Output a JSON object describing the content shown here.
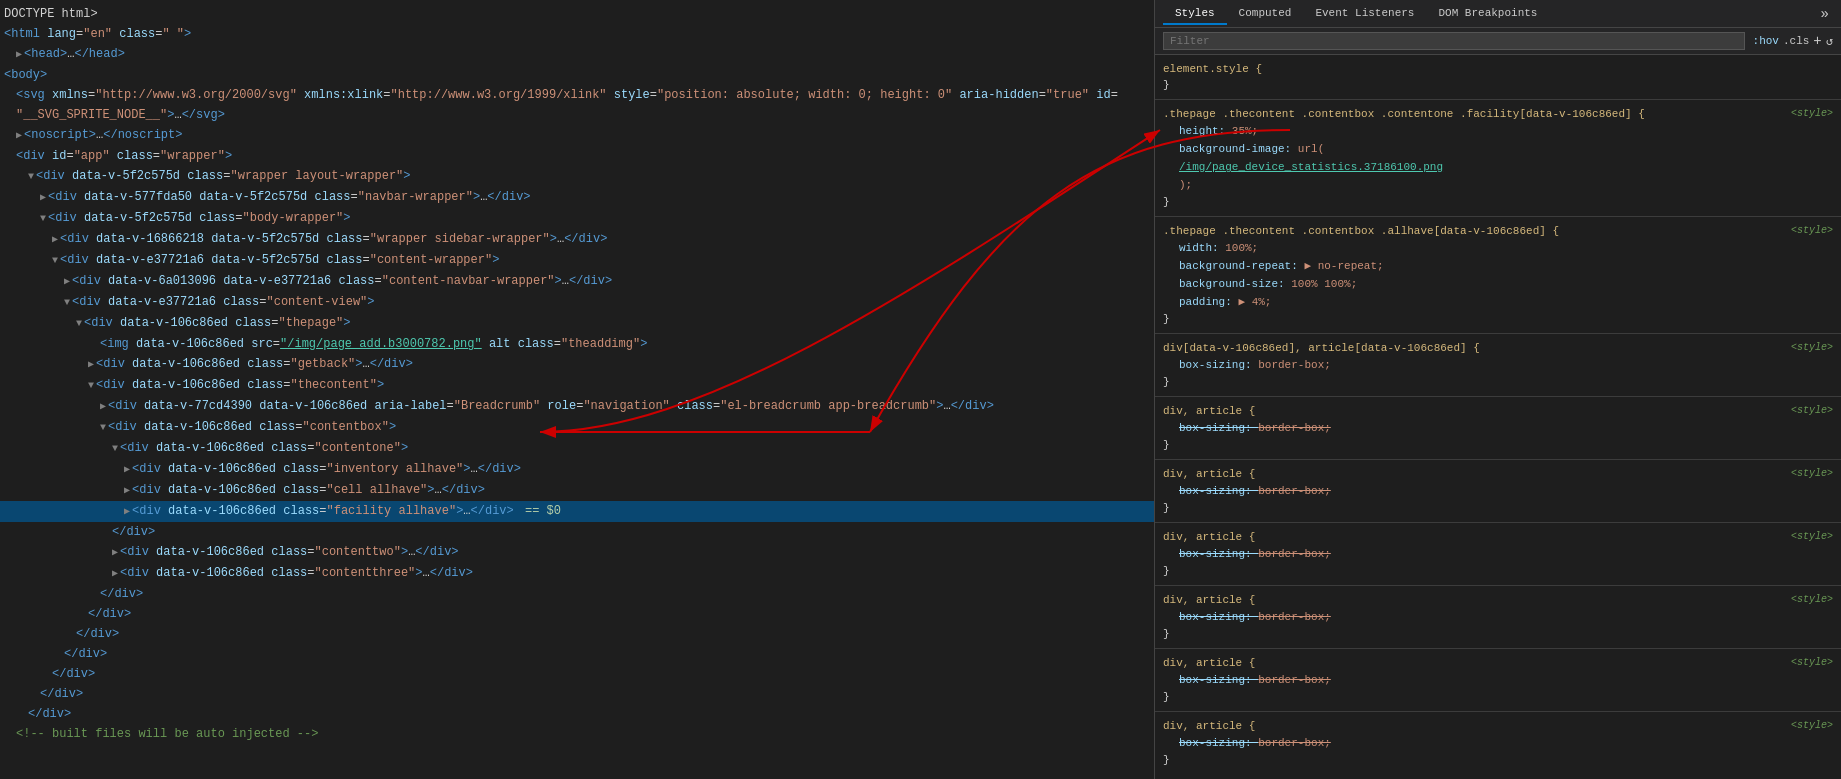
{
  "dom_panel": {
    "lines": [
      {
        "id": 0,
        "indent": 0,
        "selected": false,
        "content": "DOCTYPE html>",
        "type": "doctype"
      },
      {
        "id": 1,
        "indent": 0,
        "selected": false,
        "html": "<span class='tag'>&lt;html</span> <span class='attr-name'>lang</span><span class='equals'>=</span><span class='attr-value'>\"en\"</span> <span class='attr-name'>class</span><span class='equals'>=</span><span class='attr-value'>\" \"</span><span class='tag'>&gt;</span>"
      },
      {
        "id": 2,
        "indent": 1,
        "selected": false,
        "html": "<span class='triangle'>▶</span><span class='tag'>&lt;head&gt;</span>…<span class='tag'>&lt;/head&gt;</span>"
      },
      {
        "id": 3,
        "indent": 0,
        "selected": false,
        "html": "<span class='tag'>&lt;body&gt;</span>"
      },
      {
        "id": 4,
        "indent": 1,
        "selected": false,
        "html": "<span class='tag'>&lt;svg</span> <span class='attr-name'>xmlns</span><span class='equals'>=</span><span class='attr-value'>\"http://www.w3.org/2000/svg\"</span> <span class='attr-name'>xmlns:xlink</span><span class='equals'>=</span><span class='attr-value'>\"http://www.w3.org/1999/xlink\"</span> <span class='attr-name'>style</span><span class='equals'>=</span><span class='attr-value'>\"position: absolute; width: 0; height: 0\"</span> <span class='attr-name'>aria-hidden</span><span class='equals'>=</span><span class='attr-value'>\"true\"</span> <span class='attr-name'>id</span><span class='equals'>=</span>"
      },
      {
        "id": 5,
        "indent": 1,
        "selected": false,
        "html": "<span class='attr-value'>\"__SVG_SPRITE_NODE__\"</span><span class='tag'>&gt;</span>…<span class='tag'>&lt;/svg&gt;</span>"
      },
      {
        "id": 6,
        "indent": 1,
        "selected": false,
        "html": "<span class='triangle'>▶</span><span class='tag'>&lt;noscript&gt;</span>…<span class='tag'>&lt;/noscript&gt;</span>"
      },
      {
        "id": 7,
        "indent": 1,
        "selected": false,
        "html": "<span class='tag'>&lt;div</span> <span class='attr-name'>id</span><span class='equals'>=</span><span class='attr-value'>\"app\"</span> <span class='attr-name'>class</span><span class='equals'>=</span><span class='attr-value'>\"wrapper\"</span><span class='tag'>&gt;</span>"
      },
      {
        "id": 8,
        "indent": 2,
        "selected": false,
        "html": "<span class='triangle'>▼</span><span class='tag'>&lt;div</span> <span class='attr-name'>data-v-5f2c575d</span> <span class='attr-name'>class</span><span class='equals'>=</span><span class='attr-value'>\"wrapper layout-wrapper\"</span><span class='tag'>&gt;</span>"
      },
      {
        "id": 9,
        "indent": 3,
        "selected": false,
        "html": "<span class='triangle'>▶</span><span class='tag'>&lt;div</span> <span class='attr-name'>data-v-577fda50</span> <span class='attr-name'>data-v-5f2c575d</span> <span class='attr-name'>class</span><span class='equals'>=</span><span class='attr-value'>\"navbar-wrapper\"</span><span class='tag'>&gt;</span>…<span class='tag'>&lt;/div&gt;</span>"
      },
      {
        "id": 10,
        "indent": 3,
        "selected": false,
        "html": "<span class='triangle'>▼</span><span class='tag'>&lt;div</span> <span class='attr-name'>data-v-5f2c575d</span> <span class='attr-name'>class</span><span class='equals'>=</span><span class='attr-value'>\"body-wrapper\"</span><span class='tag'>&gt;</span>"
      },
      {
        "id": 11,
        "indent": 4,
        "selected": false,
        "html": "<span class='triangle'>▶</span><span class='tag'>&lt;div</span> <span class='attr-name'>data-v-16866218</span> <span class='attr-name'>data-v-5f2c575d</span> <span class='attr-name'>class</span><span class='equals'>=</span><span class='attr-value'>\"wrapper sidebar-wrapper\"</span><span class='tag'>&gt;</span>…<span class='tag'>&lt;/div&gt;</span>"
      },
      {
        "id": 12,
        "indent": 4,
        "selected": false,
        "html": "<span class='triangle'>▼</span><span class='tag'>&lt;div</span> <span class='attr-name'>data-v-e37721a6</span> <span class='attr-name'>data-v-5f2c575d</span> <span class='attr-name'>class</span><span class='equals'>=</span><span class='attr-value'>\"content-wrapper\"</span><span class='tag'>&gt;</span>"
      },
      {
        "id": 13,
        "indent": 5,
        "selected": false,
        "html": "<span class='triangle'>▶</span><span class='tag'>&lt;div</span> <span class='attr-name'>data-v-6a013096</span> <span class='attr-name'>data-v-e37721a6</span> <span class='attr-name'>class</span><span class='equals'>=</span><span class='attr-value'>\"content-navbar-wrapper\"</span><span class='tag'>&gt;</span>…<span class='tag'>&lt;/div&gt;</span>"
      },
      {
        "id": 14,
        "indent": 5,
        "selected": false,
        "html": "<span class='triangle'>▼</span><span class='tag'>&lt;div</span> <span class='attr-name'>data-v-e37721a6</span> <span class='attr-name'>class</span><span class='equals'>=</span><span class='attr-value'>\"content-view\"</span><span class='tag'>&gt;</span>"
      },
      {
        "id": 15,
        "indent": 6,
        "selected": false,
        "html": "<span class='triangle'>▼</span><span class='tag'>&lt;div</span> <span class='attr-name'>data-v-106c86ed</span> <span class='attr-name'>class</span><span class='equals'>=</span><span class='attr-value'>\"thepage\"</span><span class='tag'>&gt;</span>"
      },
      {
        "id": 16,
        "indent": 7,
        "selected": false,
        "html": "<span class='triangle-placeholder'></span><span class='tag'>&lt;img</span> <span class='attr-name'>data-v-106c86ed</span> <span class='attr-name'>src</span><span class='equals'>=</span><span class='attr-value attr-link'><a class='link-text' href='#'>\"/img/page_add.b3000782.png\"</a></span> <span class='attr-name'>alt</span> <span class='attr-name'>class</span><span class='equals'>=</span><span class='attr-value'>\"theaddimg\"</span><span class='tag'>&gt;</span>"
      },
      {
        "id": 17,
        "indent": 7,
        "selected": false,
        "html": "<span class='triangle'>▶</span><span class='tag'>&lt;div</span> <span class='attr-name'>data-v-106c86ed</span> <span class='attr-name'>class</span><span class='equals'>=</span><span class='attr-value'>\"getback\"</span><span class='tag'>&gt;</span>…<span class='tag'>&lt;/div&gt;</span>"
      },
      {
        "id": 18,
        "indent": 7,
        "selected": false,
        "html": "<span class='triangle'>▼</span><span class='tag'>&lt;div</span> <span class='attr-name'>data-v-106c86ed</span> <span class='attr-name'>class</span><span class='equals'>=</span><span class='attr-value'>\"thecontent\"</span><span class='tag'>&gt;</span>"
      },
      {
        "id": 19,
        "indent": 8,
        "selected": false,
        "html": "<span class='triangle'>▶</span><span class='tag'>&lt;div</span> <span class='attr-name'>data-v-77cd4390</span> <span class='attr-name'>data-v-106c86ed</span> <span class='attr-name'>aria-label</span><span class='equals'>=</span><span class='attr-value'>\"Breadcrumb\"</span> <span class='attr-name'>role</span><span class='equals'>=</span><span class='attr-value'>\"navigation\"</span> <span class='attr-name'>class</span><span class='equals'>=</span><span class='attr-value'>\"el-breadcrumb app-breadcrumb\"</span><span class='tag'>&gt;</span>…<span class='tag'>&lt;/div&gt;</span>"
      },
      {
        "id": 20,
        "indent": 8,
        "selected": false,
        "html": "<span class='triangle'>▼</span><span class='tag'>&lt;div</span> <span class='attr-name'>data-v-106c86ed</span> <span class='attr-name'>class</span><span class='equals'>=</span><span class='attr-value'>\"contentbox\"</span><span class='tag'>&gt;</span>"
      },
      {
        "id": 21,
        "indent": 9,
        "selected": false,
        "html": "<span class='triangle'>▼</span><span class='tag'>&lt;div</span> <span class='attr-name'>data-v-106c86ed</span> <span class='attr-name'>class</span><span class='equals'>=</span><span class='attr-value'>\"contentone\"</span><span class='tag'>&gt;</span>"
      },
      {
        "id": 22,
        "indent": 10,
        "selected": false,
        "html": "<span class='triangle'>▶</span><span class='tag'>&lt;div</span> <span class='attr-name'>data-v-106c86ed</span> <span class='attr-name'>class</span><span class='equals'>=</span><span class='attr-value'>\"inventory allhave\"</span><span class='tag'>&gt;</span>…<span class='tag'>&lt;/div&gt;</span>"
      },
      {
        "id": 23,
        "indent": 10,
        "selected": false,
        "html": "<span class='triangle'>▶</span><span class='tag'>&lt;div</span> <span class='attr-name'>data-v-106c86ed</span> <span class='attr-name'>class</span><span class='equals'>=</span><span class='attr-value'>\"cell allhave\"</span><span class='tag'>&gt;</span>…<span class='tag'>&lt;/div&gt;</span>"
      },
      {
        "id": 24,
        "indent": 10,
        "selected": true,
        "html": "<span class='triangle'>▶</span><span class='tag'>&lt;div</span> <span class='attr-name'>data-v-106c86ed</span> <span class='attr-name'>class</span><span class='equals'>=</span><span class='attr-value'>\"facility allhave\"</span><span class='tag'>&gt;</span>…<span class='tag'>&lt;/div&gt;</span> <span class='selected-marker'>== $0</span>"
      },
      {
        "id": 25,
        "indent": 9,
        "selected": false,
        "html": "<span class='tag'>&lt;/div&gt;</span>"
      },
      {
        "id": 26,
        "indent": 9,
        "selected": false,
        "html": "<span class='triangle'>▶</span><span class='tag'>&lt;div</span> <span class='attr-name'>data-v-106c86ed</span> <span class='attr-name'>class</span><span class='equals'>=</span><span class='attr-value'>\"contenttwo\"</span><span class='tag'>&gt;</span>…<span class='tag'>&lt;/div&gt;</span>"
      },
      {
        "id": 27,
        "indent": 9,
        "selected": false,
        "html": "<span class='triangle'>▶</span><span class='tag'>&lt;div</span> <span class='attr-name'>data-v-106c86ed</span> <span class='attr-name'>class</span><span class='equals'>=</span><span class='attr-value'>\"contentthree\"</span><span class='tag'>&gt;</span>…<span class='tag'>&lt;/div&gt;</span>"
      },
      {
        "id": 28,
        "indent": 8,
        "selected": false,
        "html": "<span class='tag'>&lt;/div&gt;</span>"
      },
      {
        "id": 29,
        "indent": 7,
        "selected": false,
        "html": "<span class='tag'>&lt;/div&gt;</span>"
      },
      {
        "id": 30,
        "indent": 6,
        "selected": false,
        "html": "<span class='tag'>&lt;/div&gt;</span>"
      },
      {
        "id": 31,
        "indent": 5,
        "selected": false,
        "html": "<span class='tag'>&lt;/div&gt;</span>"
      },
      {
        "id": 32,
        "indent": 4,
        "selected": false,
        "html": "<span class='tag'>&lt;/div&gt;</span>"
      },
      {
        "id": 33,
        "indent": 3,
        "selected": false,
        "html": "<span class='tag'>&lt;/div&gt;</span>"
      },
      {
        "id": 34,
        "indent": 2,
        "selected": false,
        "html": "<span class='tag'>&lt;/div&gt;</span>"
      },
      {
        "id": 35,
        "indent": 1,
        "selected": false,
        "html": "<span class='comment'>&lt;!-- built files will be auto injected --&gt;</span>"
      }
    ]
  },
  "styles_panel": {
    "tabs": [
      {
        "label": "Styles",
        "active": true
      },
      {
        "label": "Computed",
        "active": false
      },
      {
        "label": "Event Listeners",
        "active": false
      },
      {
        "label": "DOM Breakpoints",
        "active": false
      }
    ],
    "filter_placeholder": "Filter",
    "filter_pseudo": ":hov",
    "filter_cls": ".cls",
    "rules": [
      {
        "selector": "element.style {",
        "source": "",
        "properties": [],
        "closing": "}"
      },
      {
        "selector": ".thepage .thecontent .contentbox .contentone .facility[data-v-106c86ed] {",
        "source": "<style>",
        "properties": [
          {
            "name": "height",
            "value": "35%;",
            "strikethrough": false,
            "arrow": true
          },
          {
            "name": "background-image",
            "value": "url(",
            "strikethrough": false
          },
          {
            "name": "",
            "value": "/img/page_device_statistics.37186100.png",
            "strikethrough": false,
            "is_link": true
          },
          {
            "name": "",
            "value": ");",
            "strikethrough": false
          }
        ],
        "closing": "}"
      },
      {
        "selector": ".thepage .thecontent .contentbox .allhave[data-v-106c86ed] {",
        "source": "<style>",
        "properties": [
          {
            "name": "width",
            "value": "100%;",
            "strikethrough": false
          },
          {
            "name": "background-repeat",
            "value": "▶ no-repeat;",
            "strikethrough": false
          },
          {
            "name": "background-size",
            "value": "100% 100%;",
            "strikethrough": false
          },
          {
            "name": "padding",
            "value": "▶ 4%;",
            "strikethrough": false
          }
        ],
        "closing": "}"
      },
      {
        "selector": "div[data-v-106c86ed], article[data-v-106c86ed] {",
        "source": "<style>",
        "properties": [
          {
            "name": "box-sizing",
            "value": "border-box;",
            "strikethrough": false
          }
        ],
        "closing": "}"
      },
      {
        "selector": "div, article {",
        "source": "<style>",
        "properties": [
          {
            "name": "box-sizing",
            "value": "border-box;",
            "strikethrough": true
          }
        ],
        "closing": "}"
      },
      {
        "selector": "div, article {",
        "source": "<style>",
        "properties": [
          {
            "name": "box-sizing",
            "value": "border-box;",
            "strikethrough": true
          }
        ],
        "closing": "}"
      },
      {
        "selector": "div, article {",
        "source": "<style>",
        "properties": [
          {
            "name": "box-sizing",
            "value": "border-box;",
            "strikethrough": true
          }
        ],
        "closing": "}"
      },
      {
        "selector": "div, article {",
        "source": "<style>",
        "properties": [
          {
            "name": "box-sizing",
            "value": "border-box;",
            "strikethrough": true
          }
        ],
        "closing": "}"
      },
      {
        "selector": "div, article {",
        "source": "<style>",
        "properties": [
          {
            "name": "box-sizing",
            "value": "border-box;",
            "strikethrough": true
          }
        ],
        "closing": "}"
      },
      {
        "selector": "div, article {",
        "source": "<style>",
        "properties": [
          {
            "name": "box-sizing",
            "value": "border-box;",
            "strikethrough": true
          }
        ],
        "closing": "}"
      }
    ]
  },
  "arrows": {
    "arrow1": {
      "from_description": "styles panel height property",
      "to_description": "dom element facility allhave"
    },
    "arrow2": {
      "from_description": "dom element facility allhave selected",
      "to_description": "styles panel selected element"
    }
  }
}
